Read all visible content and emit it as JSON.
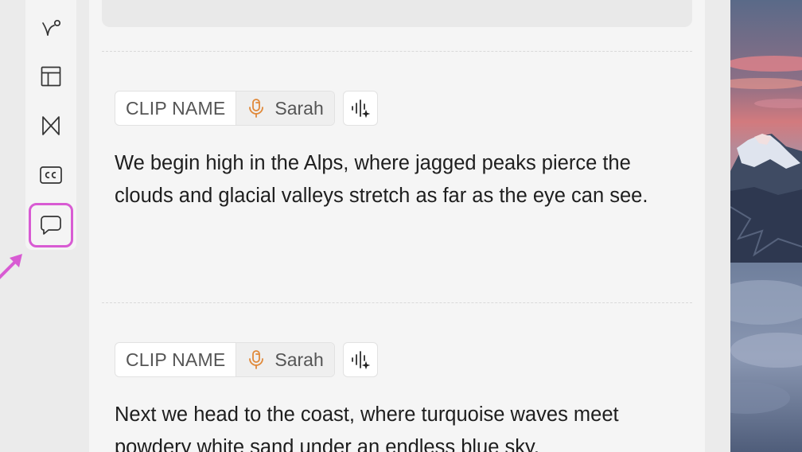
{
  "rail": {
    "items": [
      {
        "name": "curve-tool",
        "icon": "path-curve-icon"
      },
      {
        "name": "layout",
        "icon": "layout-icon"
      },
      {
        "name": "transitions",
        "icon": "transition-bowtie-icon"
      },
      {
        "name": "captions",
        "icon": "cc-icon"
      },
      {
        "name": "comments",
        "icon": "speech-bubble-icon",
        "highlighted": true
      }
    ]
  },
  "clips": [
    {
      "name_label": "CLIP NAME",
      "speaker": "Sarah",
      "text": "We begin high in the Alps, where jagged peaks pierce the clouds and glacial valleys stretch as far as the eye can see."
    },
    {
      "name_label": "CLIP NAME",
      "speaker": "Sarah",
      "text": "Next we head to the coast, where turquoise waves meet powdery white sand under an endless blue sky."
    }
  ],
  "colors": {
    "highlight": "#d85bd3",
    "mic_accent": "#e0893a",
    "text": "#1e1e1e"
  }
}
